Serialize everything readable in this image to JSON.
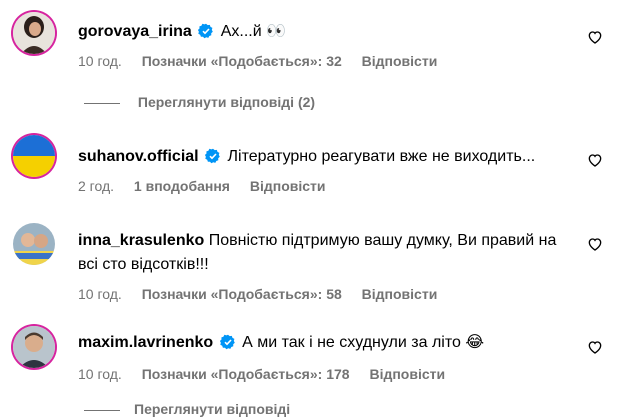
{
  "comments": [
    {
      "username": "gorovaya_irina",
      "verified": true,
      "text": "Ах...й 👀",
      "time": "10 год.",
      "likes": "Позначки «Подобається»: 32",
      "reply": "Відповісти",
      "view_replies": "Переглянути відповіді (2)",
      "avatar_icon": "profile-photo-woman"
    },
    {
      "username": "suhanov.official",
      "verified": true,
      "text": "Літературно реагувати вже не виходить...",
      "time": "2 год.",
      "likes": "1 вподобання",
      "reply": "Відповісти",
      "avatar_icon": "ukraine-flag-avatar"
    },
    {
      "username": "inna_krasulenko",
      "verified": false,
      "text": "Повністю підтримую вашу думку, Ви правий на всі сто відсотків!!!",
      "time": "10 год.",
      "likes": "Позначки «Подобається»: 58",
      "reply": "Відповісти",
      "avatar_icon": "profile-photo-two-people"
    },
    {
      "username": "maxim.lavrinenko",
      "verified": true,
      "text": "А ми так і не схуднули за літо 😂",
      "time": "10 год.",
      "likes": "Позначки «Подобається»: 178",
      "reply": "Відповісти",
      "avatar_icon": "profile-photo-man"
    }
  ],
  "partial_bottom_text": "Переглянути відповіді",
  "colors": {
    "verified_blue": "#0095f6",
    "meta_gray": "#737373",
    "story_ring": "#d6249f"
  }
}
